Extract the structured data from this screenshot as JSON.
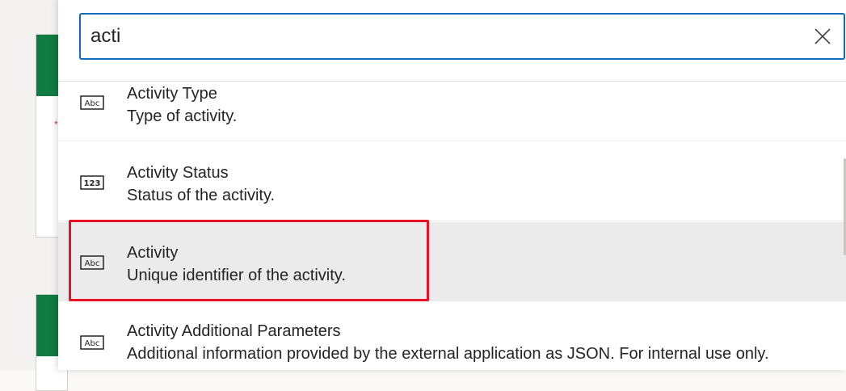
{
  "search": {
    "value": "acti",
    "clear_icon": "close-icon"
  },
  "results": [
    {
      "name": "Activity Type",
      "description": "Type of activity.",
      "type_icon": "Abc",
      "selected": false
    },
    {
      "name": "Activity Status",
      "description": "Status of the activity.",
      "type_icon": "123",
      "selected": false
    },
    {
      "name": "Activity",
      "description": "Unique identifier of the activity.",
      "type_icon": "Abc",
      "selected": true
    },
    {
      "name": "Activity Additional Parameters",
      "description": "Additional information provided by the external application as JSON. For internal use only.",
      "type_icon": "Abc",
      "selected": false
    }
  ],
  "colors": {
    "focus_border": "#0f6cbd",
    "highlight_border": "#e81123",
    "selected_bg": "#ebebeb",
    "brand_green": "#107c41"
  }
}
